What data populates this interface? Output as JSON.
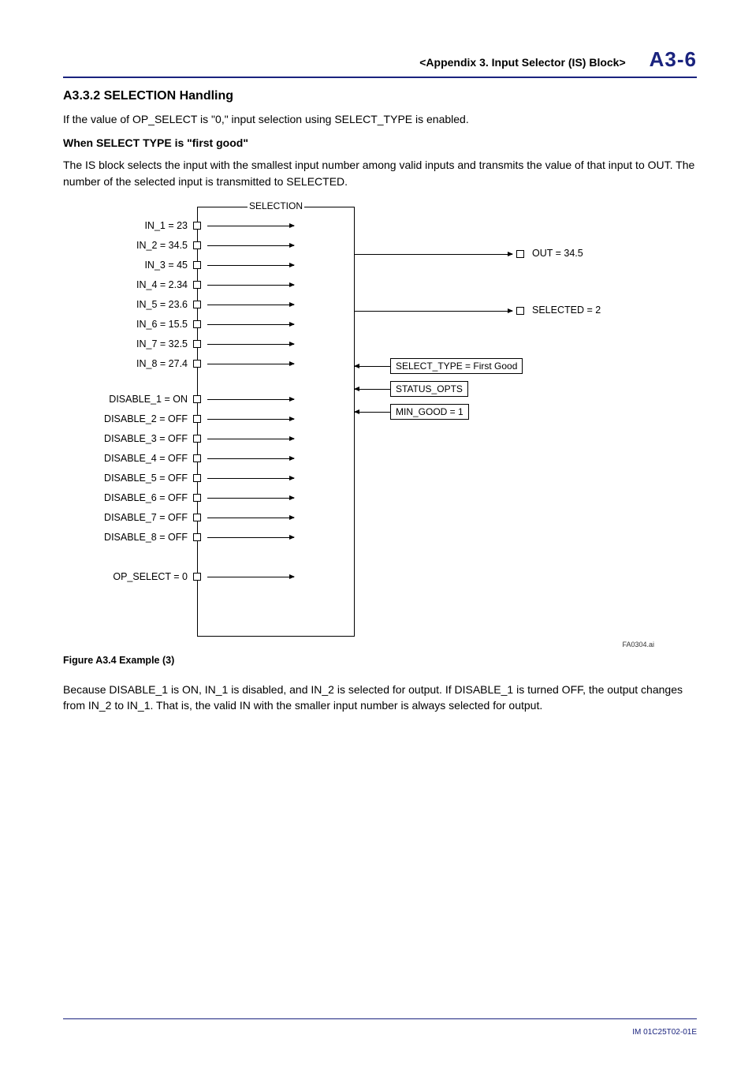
{
  "header": {
    "section": "<Appendix 3.  Input Selector (IS) Block>",
    "page": "A3-6"
  },
  "h3": "A3.3.2   SELECTION Handling",
  "p1": "If the value of OP_SELECT is \"0,\" input selection using SELECT_TYPE is enabled.",
  "h4": "When SELECT TYPE is \"first good\"",
  "p2": "The IS block selects the input with the smallest input number among valid inputs and transmits the value of that input to OUT. The number of the selected input is transmitted to SELECTED.",
  "diagram": {
    "title": "SELECTION",
    "ins": [
      "IN_1 = 23",
      "IN_2 = 34.5",
      "IN_3 = 45",
      "IN_4 = 2.34",
      "IN_5 = 23.6",
      "IN_6 = 15.5",
      "IN_7 = 32.5",
      "IN_8 = 27.4"
    ],
    "disables": [
      "DISABLE_1 = ON",
      "DISABLE_2 = OFF",
      "DISABLE_3 = OFF",
      "DISABLE_4 = OFF",
      "DISABLE_5 = OFF",
      "DISABLE_6 = OFF",
      "DISABLE_7 = OFF",
      "DISABLE_8 = OFF"
    ],
    "op_select": "OP_SELECT = 0",
    "out": "OUT = 34.5",
    "selected": "SELECTED = 2",
    "params": {
      "select_type": "SELECT_TYPE = First Good",
      "status_opts": "STATUS_OPTS",
      "min_good": "MIN_GOOD = 1"
    },
    "ref": "FA0304.ai"
  },
  "caption": "Figure A3.4    Example (3)",
  "p3": "Because DISABLE_1 is ON, IN_1 is disabled, and IN_2 is selected for output. If DISABLE_1 is turned OFF, the output changes from IN_2 to IN_1. That is, the valid IN with the smaller input number is always selected for output.",
  "footer": "IM 01C25T02-01E"
}
